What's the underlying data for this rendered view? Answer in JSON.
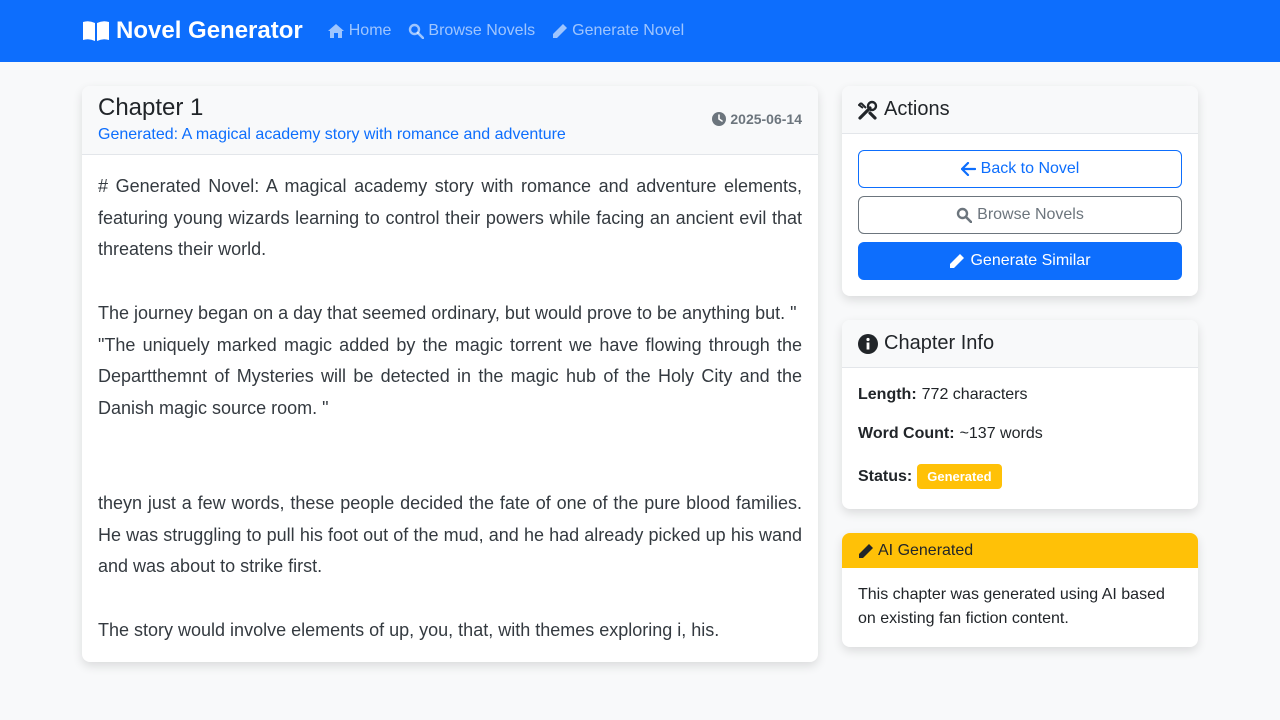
{
  "navbar": {
    "brand": "Novel Generator",
    "links": [
      {
        "label": "Home",
        "icon": "home-icon"
      },
      {
        "label": "Browse Novels",
        "icon": "search-icon"
      },
      {
        "label": "Generate Novel",
        "icon": "pencil-icon"
      }
    ]
  },
  "chapter": {
    "title": "Chapter 1",
    "subtitle": "Generated: A magical academy story with romance and adventure",
    "date": "2025-06-14",
    "paragraphs": [
      "# Generated Novel: A magical academy story with romance and adventure elements, featuring young wizards learning to control their powers while facing an ancient evil that threatens their world.",
      "The journey began on a day that seemed ordinary, but would prove to be anything but. \"",
      "\"The uniquely marked magic added by the magic torrent we have flowing through the Departthemnt of Mysteries will be detected in the magic hub of the Holy City and the Danish magic source room. \"",
      "theyn just a few words, these people decided the fate of one of the pure blood families. He was struggling to pull his foot out of the mud, and he had already picked up his wand and was about to strike first.",
      "The story would involve elements of up, you, that, with themes exploring i, his."
    ]
  },
  "actions": {
    "title": "Actions",
    "back_label": "Back to Novel",
    "browse_label": "Browse Novels",
    "generate_label": "Generate Similar"
  },
  "chapter_info": {
    "title": "Chapter Info",
    "length_label": "Length:",
    "length_value": "772 characters",
    "word_count_label": "Word Count:",
    "word_count_value": "~137 words",
    "status_label": "Status:",
    "status_value": "Generated"
  },
  "ai_notice": {
    "title": "AI Generated",
    "text": "This chapter was generated using AI based on existing fan fiction content."
  },
  "colors": {
    "primary": "#0d6efd",
    "warning": "#ffc107",
    "secondary": "#6c757d"
  }
}
